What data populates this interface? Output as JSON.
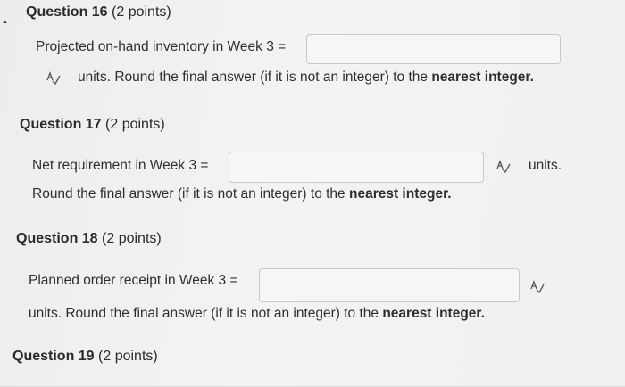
{
  "icons": {
    "collapse": "collapse-arrow-icon",
    "spellcheck": "spellcheck-icon"
  },
  "q16": {
    "number": "Question 16",
    "points": "(2 points)",
    "prompt": "Projected on-hand inventory in Week 3 =",
    "units_pre": "units. Round the final answer (if it is not an integer) to the ",
    "units_bold": "nearest integer.",
    "value": ""
  },
  "q17": {
    "number": "Question 17",
    "points": "(2 points)",
    "prompt": "Net requirement in Week 3 =",
    "units": "units.",
    "round_pre": "Round the final answer (if it is not an integer) to the ",
    "round_bold": "nearest integer.",
    "value": ""
  },
  "q18": {
    "number": "Question 18",
    "points": "(2 points)",
    "prompt": "Planned order receipt in Week 3 =",
    "units_pre": "units. Round the final answer (if it is not an integer) to the ",
    "units_bold": "nearest integer.",
    "value": ""
  },
  "q19": {
    "number": "Question 19",
    "points": "(2 points)"
  }
}
